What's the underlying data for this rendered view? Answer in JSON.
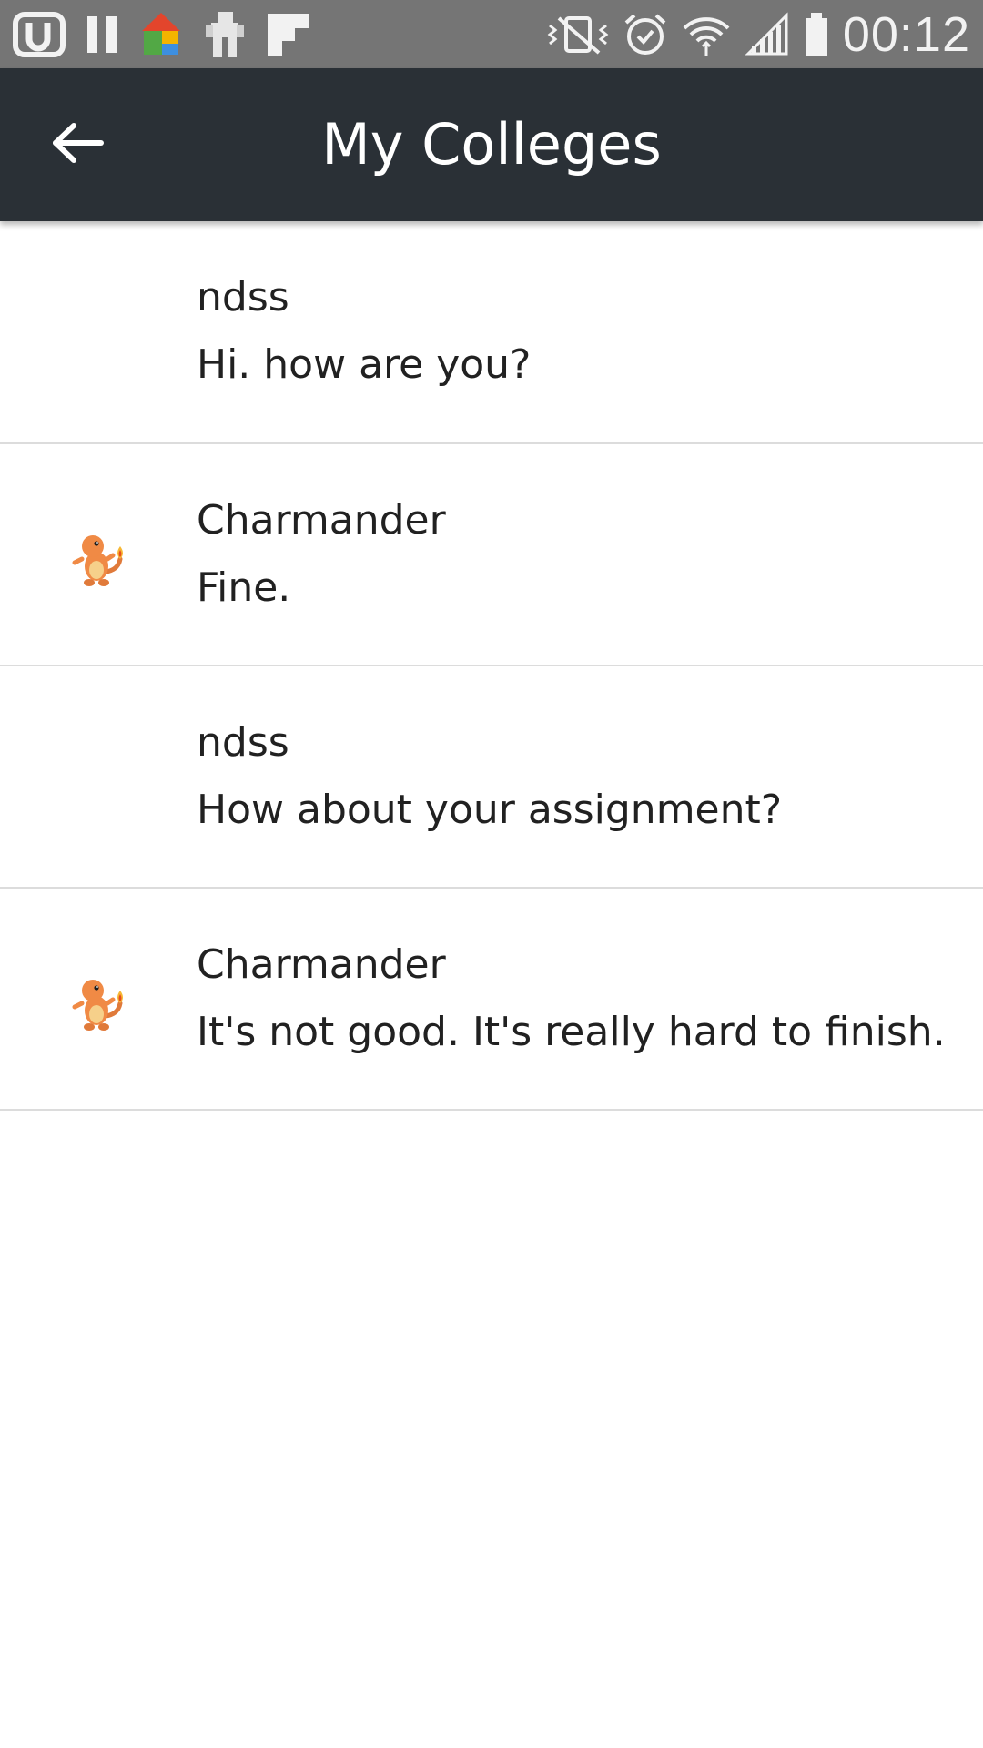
{
  "status_bar": {
    "time": "00:12",
    "left_icons": [
      "u-badge-icon",
      "pause-icon",
      "home-launcher-icon",
      "robot-icon",
      "flipboard-icon"
    ],
    "right_icons": [
      "vibrate-mute-icon",
      "alarm-icon",
      "wifi-icon",
      "signal-icon",
      "battery-icon"
    ]
  },
  "app_bar": {
    "title": "My Colleges",
    "back_icon": "arrow-left-icon",
    "background": "#2a3036"
  },
  "messages": [
    {
      "sender": "ndss",
      "text": "Hi. how are you?",
      "avatar": ""
    },
    {
      "sender": "Charmander",
      "text": "Fine.",
      "avatar": "charmander-avatar"
    },
    {
      "sender": "ndss",
      "text": "How about your assignment?",
      "avatar": ""
    },
    {
      "sender": "Charmander",
      "text": "It's not good. It's really hard to finish. It",
      "avatar": "charmander-avatar"
    }
  ]
}
